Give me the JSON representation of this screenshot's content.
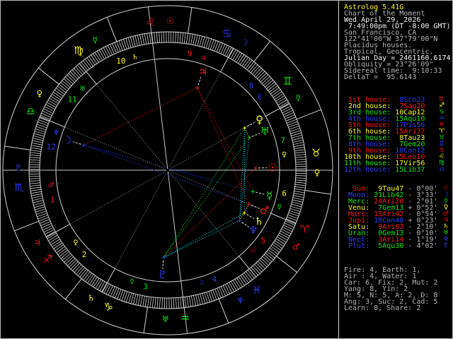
{
  "app_title": "Astrolog 5.41G",
  "panel": {
    "header_lines": [
      {
        "text": "Astrolog 5.41G",
        "color": "yellow"
      },
      {
        "text": "Chart of the Moment",
        "color": "gray"
      },
      {
        "text": "Wed April 29, 2026",
        "color": "white"
      },
      {
        "text": " 7:49:00pm (DT -8:00 GMT)",
        "color": "white"
      },
      {
        "text": "San Francisco, CA",
        "color": "gray"
      },
      {
        "text": "122°41'00\"W 37°79'00\"N",
        "color": "gray"
      },
      {
        "text": "Placidus houses.",
        "color": "gray"
      },
      {
        "text": "Tropical, Geocentric.",
        "color": "gray"
      },
      {
        "text": "Julian Day = 2461160.6174",
        "color": "white"
      },
      {
        "text": "Obliquity = 23°26'09\"",
        "color": "gray"
      },
      {
        "text": "Sidereal time:  9:10:33",
        "color": "gray"
      },
      {
        "text": "DeltaT =  95.6143",
        "color": "gray"
      }
    ],
    "houses": [
      {
        "label": " 1st house:",
        "value": " 8Sco23",
        "glyph": "♏",
        "label_color": "red",
        "value_color": "blue",
        "glyph_color": "red"
      },
      {
        "label": " 2nd house:",
        "value": " 7Sag20",
        "glyph": "♐",
        "label_color": "yellow",
        "value_color": "red",
        "glyph_color": "yellow"
      },
      {
        "label": " 3rd house:",
        "value": "10Cap12",
        "glyph": "♑",
        "label_color": "green",
        "value_color": "yellow",
        "glyph_color": "green"
      },
      {
        "label": " 4th house:",
        "value": "15Aqu10",
        "glyph": "♒",
        "label_color": "blue",
        "value_color": "green",
        "glyph_color": "blue"
      },
      {
        "label": " 5th house:",
        "value": "17Pis56",
        "glyph": "♓",
        "label_color": "red",
        "value_color": "blue",
        "glyph_color": "red"
      },
      {
        "label": " 6th house:",
        "value": "15Ari37",
        "glyph": "♈",
        "label_color": "yellow",
        "value_color": "red",
        "glyph_color": "yellow"
      },
      {
        "label": " 7th house:",
        "value": " 8Tau23",
        "glyph": "♉",
        "label_color": "green",
        "value_color": "yellow",
        "glyph_color": "green"
      },
      {
        "label": " 8th house:",
        "value": " 7Gem20",
        "glyph": "♊",
        "label_color": "blue",
        "value_color": "green",
        "glyph_color": "blue"
      },
      {
        "label": " 9th house:",
        "value": "10Can12",
        "glyph": "♋",
        "label_color": "red",
        "value_color": "blue",
        "glyph_color": "red"
      },
      {
        "label": "10th house:",
        "value": "15Leo10",
        "glyph": "♌",
        "label_color": "yellow",
        "value_color": "red",
        "glyph_color": "yellow"
      },
      {
        "label": "11th house:",
        "value": "17Vir56",
        "glyph": "♍",
        "label_color": "green",
        "value_color": "yellow",
        "glyph_color": "green"
      },
      {
        "label": "12th house:",
        "value": "15Lib37",
        "glyph": "♎",
        "label_color": "blue",
        "value_color": "green",
        "glyph_color": "blue"
      }
    ],
    "planets": [
      {
        "label": "  Sun:",
        "value": " 9Tau47",
        "velocity": "- 0°00'",
        "glyph": "☉",
        "label_color": "red",
        "value_color": "yellow",
        "glyph_color": "red"
      },
      {
        "label": " Moon:",
        "value": "21Lib42",
        "velocity": "- 3°33'",
        "glyph": "☽",
        "label_color": "blue",
        "value_color": "green",
        "glyph_color": "blue"
      },
      {
        "label": " Merc:",
        "value": "24Ari20",
        "velocity": "- 2°01'",
        "glyph": "☿",
        "label_color": "green",
        "value_color": "red",
        "glyph_color": "green"
      },
      {
        "label": " Venu:",
        "value": " 7Gem13",
        "velocity": "+ 0°52'",
        "glyph": "♀",
        "label_color": "yellow",
        "value_color": "green",
        "glyph_color": "yellow"
      },
      {
        "label": " Mars:",
        "value": "15Ari42",
        "velocity": "- 0°54'",
        "glyph": "♂",
        "label_color": "red",
        "value_color": "red",
        "glyph_color": "red"
      },
      {
        "label": " Jupi:",
        "value": "18Can48",
        "velocity": "+ 0°23'",
        "glyph": "♃",
        "label_color": "red",
        "value_color": "blue",
        "glyph_color": "red"
      },
      {
        "label": " Satu:",
        "value": " 9Ari03",
        "velocity": "- 2°10'",
        "glyph": "♄",
        "label_color": "yellow",
        "value_color": "red",
        "glyph_color": "yellow"
      },
      {
        "label": " Uran:",
        "value": " 0Gem13",
        "velocity": "- 0°10'",
        "glyph": "♅",
        "label_color": "green",
        "value_color": "green",
        "glyph_color": "green"
      },
      {
        "label": " Nept:",
        "value": " 3Ari14",
        "velocity": "- 1°19'",
        "glyph": "♆",
        "label_color": "blue",
        "value_color": "red",
        "glyph_color": "blue"
      },
      {
        "label": " Plut:",
        "value": " 5Aqu30",
        "velocity": "- 4°02'",
        "glyph": "♇",
        "label_color": "blue",
        "value_color": "green",
        "glyph_color": "blue"
      }
    ],
    "summary_lines": [
      "Fire: 4, Earth: 1,",
      "Air : 4, Water: 1",
      "Car: 6, Fix: 2, Mut: 2",
      "Yang: 8, Yin: 2",
      "M: 5, N: 5, A: 2, D: 8",
      "Ang: 3, Suc: 2, Cad: 5",
      "Learn: 8, Share: 2"
    ]
  },
  "chart_data": {
    "type": "astrology_wheel",
    "title": "Chart of the Moment",
    "house_system": "Placidus",
    "ascendant_lon": 218.383,
    "house_cusps": [
      {
        "num": 1,
        "cusp": "8Sco23",
        "lon": 218.383,
        "num_color": "red",
        "natural_ruler": "♂",
        "ruler_color": "red"
      },
      {
        "num": 2,
        "cusp": "7Sag20",
        "lon": 247.333,
        "num_color": "yellow",
        "natural_ruler": "♀",
        "ruler_color": "yellow"
      },
      {
        "num": 3,
        "cusp": "10Cap12",
        "lon": 280.2,
        "num_color": "green",
        "natural_ruler": "☿",
        "ruler_color": "green"
      },
      {
        "num": 4,
        "cusp": "15Aqu10",
        "lon": 315.167,
        "num_color": "blue",
        "natural_ruler": "☽",
        "ruler_color": "blue"
      },
      {
        "num": 5,
        "cusp": "17Pis56",
        "lon": 347.933,
        "num_color": "red",
        "natural_ruler": "☉",
        "ruler_color": "red"
      },
      {
        "num": 6,
        "cusp": "15Ari37",
        "lon": 15.617,
        "num_color": "yellow",
        "natural_ruler": "☿",
        "ruler_color": "green"
      },
      {
        "num": 7,
        "cusp": "8Tau23",
        "lon": 38.383,
        "num_color": "green",
        "natural_ruler": "♀",
        "ruler_color": "yellow"
      },
      {
        "num": 8,
        "cusp": "7Gem20",
        "lon": 67.333,
        "num_color": "blue",
        "natural_ruler": "♇",
        "ruler_color": "blue"
      },
      {
        "num": 9,
        "cusp": "10Can12",
        "lon": 100.2,
        "num_color": "red",
        "natural_ruler": "♃",
        "ruler_color": "red"
      },
      {
        "num": 10,
        "cusp": "15Leo10",
        "lon": 135.167,
        "num_color": "yellow",
        "natural_ruler": "♄",
        "ruler_color": "yellow"
      },
      {
        "num": 11,
        "cusp": "17Vir56",
        "lon": 167.933,
        "num_color": "green",
        "natural_ruler": "♅",
        "ruler_color": "green"
      },
      {
        "num": 12,
        "cusp": "15Lib37",
        "lon": 195.617,
        "num_color": "blue",
        "natural_ruler": "♆",
        "ruler_color": "blue"
      }
    ],
    "signs": [
      {
        "name": "Aries",
        "glyph": "♈",
        "color": "red",
        "ruler_glyph": "♂",
        "ruler_color": "red"
      },
      {
        "name": "Taurus",
        "glyph": "♉",
        "color": "yellow",
        "ruler_glyph": "♀",
        "ruler_color": "yellow"
      },
      {
        "name": "Gemini",
        "glyph": "♊",
        "color": "green",
        "ruler_glyph": "☿",
        "ruler_color": "green"
      },
      {
        "name": "Cancer",
        "glyph": "♋",
        "color": "blue",
        "ruler_glyph": "☽",
        "ruler_color": "blue"
      },
      {
        "name": "Leo",
        "glyph": "♌",
        "color": "red",
        "ruler_glyph": "☉",
        "ruler_color": "red"
      },
      {
        "name": "Virgo",
        "glyph": "♍",
        "color": "yellow",
        "ruler_glyph": "☿",
        "ruler_color": "green"
      },
      {
        "name": "Libra",
        "glyph": "♎",
        "color": "green",
        "ruler_glyph": "♀",
        "ruler_color": "yellow"
      },
      {
        "name": "Scorpio",
        "glyph": "♏",
        "color": "blue",
        "ruler_glyph": "♇",
        "ruler_color": "blue"
      },
      {
        "name": "Sagittarius",
        "glyph": "♐",
        "color": "red",
        "ruler_glyph": "♃",
        "ruler_color": "red"
      },
      {
        "name": "Capricorn",
        "glyph": "♑",
        "color": "yellow",
        "ruler_glyph": "♄",
        "ruler_color": "yellow"
      },
      {
        "name": "Aquarius",
        "glyph": "♒",
        "color": "green",
        "ruler_glyph": "♅",
        "ruler_color": "green"
      },
      {
        "name": "Pisces",
        "glyph": "♓",
        "color": "blue",
        "ruler_glyph": "♆",
        "ruler_color": "blue"
      }
    ],
    "planets": [
      {
        "name": "Sun",
        "glyph": "☉",
        "color": "red",
        "lon": 39.783,
        "position": "9Tau47"
      },
      {
        "name": "Moon",
        "glyph": "☽",
        "color": "blue",
        "lon": 201.7,
        "position": "21Lib42"
      },
      {
        "name": "Mercury",
        "glyph": "☿",
        "color": "green",
        "lon": 24.333,
        "position": "24Ari20"
      },
      {
        "name": "Venus",
        "glyph": "♀",
        "color": "yellow",
        "lon": 67.217,
        "position": "7Gem13"
      },
      {
        "name": "Mars",
        "glyph": "♂",
        "color": "red",
        "lon": 15.7,
        "position": "15Ari42"
      },
      {
        "name": "Jupiter",
        "glyph": "♃",
        "color": "red",
        "lon": 108.8,
        "position": "18Can48"
      },
      {
        "name": "Saturn",
        "glyph": "♄",
        "color": "yellow",
        "lon": 9.05,
        "position": "9Ari03"
      },
      {
        "name": "Uranus",
        "glyph": "♅",
        "color": "green",
        "lon": 60.217,
        "position": "0Gem13"
      },
      {
        "name": "Neptune",
        "glyph": "♆",
        "color": "blue",
        "lon": 3.233,
        "position": "3Ari14"
      },
      {
        "name": "Pluto",
        "glyph": "♇",
        "color": "blue",
        "lon": 305.5,
        "position": "5Aqu30"
      }
    ],
    "aspects": [
      {
        "a": "Moon",
        "b": "Mercury",
        "type": "opposition"
      },
      {
        "a": "Moon",
        "b": "Mars",
        "type": "opposition"
      },
      {
        "a": "Sun",
        "b": "Pluto",
        "type": "square"
      },
      {
        "a": "Moon",
        "b": "Jupiter",
        "type": "square"
      },
      {
        "a": "Mercury",
        "b": "Jupiter",
        "type": "square"
      },
      {
        "a": "Mars",
        "b": "Jupiter",
        "type": "square"
      },
      {
        "a": "Venus",
        "b": "Pluto",
        "type": "trine"
      },
      {
        "a": "Uranus",
        "b": "Pluto",
        "type": "trine"
      },
      {
        "a": "Venus",
        "b": "Saturn",
        "type": "sextile"
      },
      {
        "a": "Venus",
        "b": "Neptune",
        "type": "sextile"
      },
      {
        "a": "Uranus",
        "b": "Neptune",
        "type": "sextile"
      },
      {
        "a": "Saturn",
        "b": "Pluto",
        "type": "sextile"
      },
      {
        "a": "Neptune",
        "b": "Pluto",
        "type": "sextile"
      },
      {
        "a": "Mars",
        "b": "Saturn",
        "type": "conjunction"
      },
      {
        "a": "Saturn",
        "b": "Neptune",
        "type": "conjunction"
      },
      {
        "a": "Venus",
        "b": "Uranus",
        "type": "conjunction"
      }
    ],
    "aspect_colors": {
      "conjunction": "yellow",
      "sextile": "cyan",
      "square": "red",
      "trine": "green",
      "opposition": "blue"
    },
    "layout": {
      "center": [
        236,
        240
      ],
      "r_outer": 233,
      "r_sign_inner": 196,
      "r_tick_inner": 181,
      "r_inner": 158,
      "r_house_num": 168,
      "r_sign_glyph": 211,
      "r_planet_glyph": 148,
      "r_planet_dot": 124
    }
  },
  "colors": {
    "red": "#f81414",
    "yellow": "#fdfd12",
    "green": "#12e412",
    "blue": "#2b3cf8",
    "cyan": "#00e4e4",
    "gray": "#b4b4b4",
    "white": "#f6f6f6",
    "wheel_line": "#d2d2d2",
    "cusp_dotted": "#8f8f8f",
    "tick": "#ececec"
  }
}
